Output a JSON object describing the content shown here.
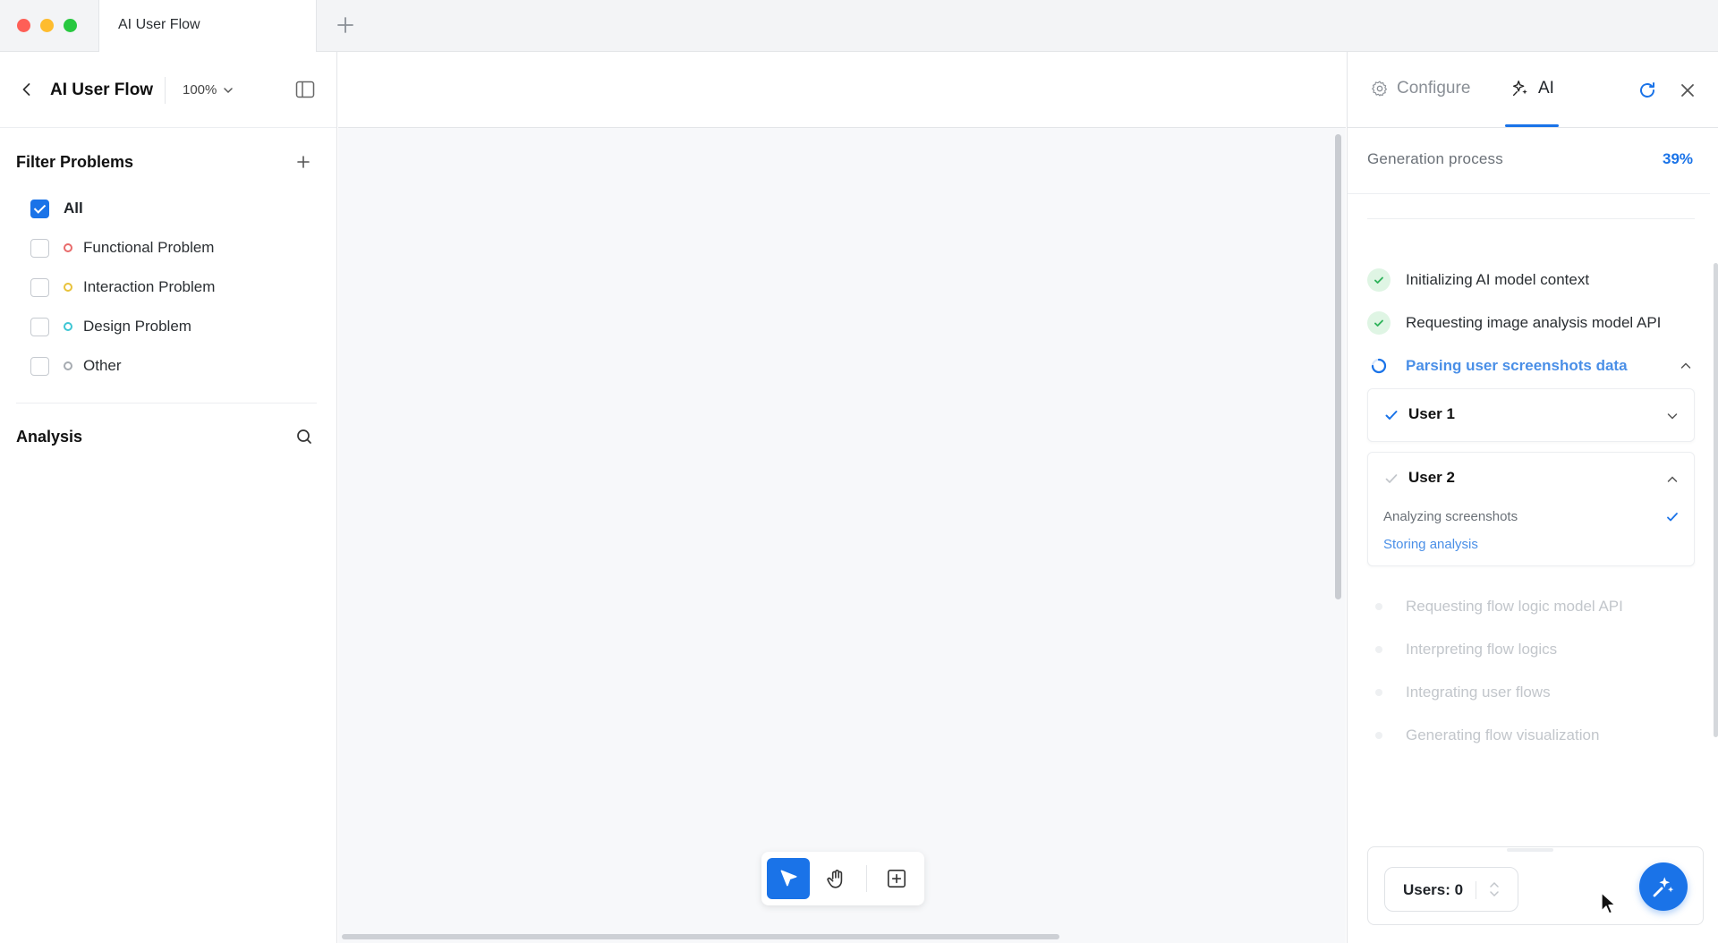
{
  "colors": {
    "accent": "#1a73e8",
    "functional": "#e86a6a",
    "interaction": "#e8c23a",
    "design": "#3ec6d4",
    "other": "#a6abb1",
    "success_bg": "#dff5e4",
    "success": "#2fb35b"
  },
  "tab": {
    "title": "AI User Flow"
  },
  "left_panel": {
    "title": "AI User Flow",
    "zoom": "100%",
    "filter_title": "Filter Problems",
    "filters": [
      {
        "label": "All",
        "checked": true
      },
      {
        "label": "Functional Problem",
        "checked": false
      },
      {
        "label": "Interaction Problem",
        "checked": false
      },
      {
        "label": "Design Problem",
        "checked": false
      },
      {
        "label": "Other",
        "checked": false
      }
    ],
    "analysis_title": "Analysis"
  },
  "right_panel": {
    "tabs": [
      {
        "label": "Configure",
        "icon": "gear-icon"
      },
      {
        "label": "AI",
        "icon": "sparkle-icon"
      }
    ],
    "generation": {
      "label": "Generation process",
      "progress": "39%"
    },
    "steps": [
      {
        "label": "Initializing AI model context",
        "state": "done"
      },
      {
        "label": "Requesting image analysis model API",
        "state": "done"
      },
      {
        "label": "Parsing user screenshots data",
        "state": "active"
      },
      {
        "label": "Requesting flow logic model API",
        "state": "pending"
      },
      {
        "label": "Interpreting flow logics",
        "state": "pending"
      },
      {
        "label": "Integrating user flows",
        "state": "pending"
      },
      {
        "label": "Generating flow visualization",
        "state": "pending"
      }
    ],
    "users": [
      {
        "title": "User 1",
        "state": "done",
        "expanded": false
      },
      {
        "title": "User 2",
        "state": "in-progress",
        "expanded": true,
        "substeps": [
          {
            "label": "Analyzing screenshots",
            "state": "done"
          },
          {
            "label": "Storing analysis",
            "state": "active"
          }
        ]
      }
    ],
    "users_count_label": "Users: 0"
  }
}
